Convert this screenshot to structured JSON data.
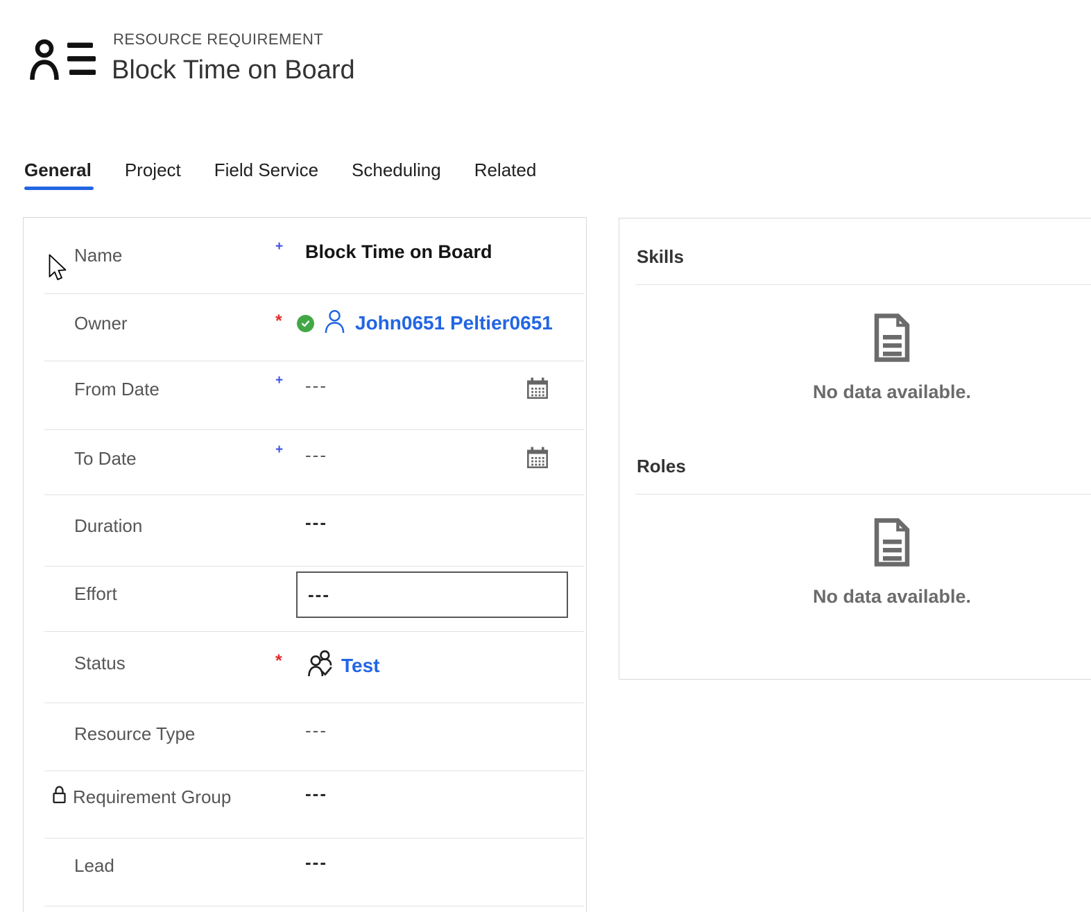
{
  "header": {
    "record_type": "RESOURCE REQUIREMENT",
    "record_title": "Block Time on Board",
    "icon": "resource-requirement-icon"
  },
  "tabs": [
    {
      "label": "General",
      "active": true
    },
    {
      "label": "Project",
      "active": false
    },
    {
      "label": "Field Service",
      "active": false
    },
    {
      "label": "Scheduling",
      "active": false
    },
    {
      "label": "Related",
      "active": false
    }
  ],
  "form": {
    "fields": [
      {
        "label": "Name",
        "marker": "+",
        "type": "text",
        "value": "Block Time on Board"
      },
      {
        "label": "Owner",
        "marker": "*",
        "type": "owner",
        "value": "John0651 Peltier0651",
        "icons": [
          "verified-check-icon",
          "person-icon"
        ]
      },
      {
        "label": "From Date",
        "marker": "+",
        "type": "date",
        "value": "---",
        "icons": [
          "calendar-icon"
        ]
      },
      {
        "label": "To Date",
        "marker": "+",
        "type": "date",
        "value": "---",
        "icons": [
          "calendar-icon"
        ]
      },
      {
        "label": "Duration",
        "marker": "",
        "type": "blank-bold",
        "value": "---"
      },
      {
        "label": "Effort",
        "marker": "",
        "type": "input",
        "value": "---"
      },
      {
        "label": "Status",
        "marker": "*",
        "type": "status",
        "value": "Test",
        "icons": [
          "people-check-icon"
        ]
      },
      {
        "label": "Resource Type",
        "marker": "",
        "type": "blank",
        "value": "---"
      },
      {
        "label": "Requirement Group",
        "marker": "",
        "type": "blank-bold",
        "value": "---",
        "locked": true,
        "icons": [
          "lock-icon"
        ]
      },
      {
        "label": "Lead",
        "marker": "",
        "type": "blank-bold",
        "value": "---"
      }
    ]
  },
  "side_sections": [
    {
      "title": "Skills",
      "empty_message": "No data available.",
      "icon": "document-icon"
    },
    {
      "title": "Roles",
      "empty_message": "No data available.",
      "icon": "document-icon"
    }
  ],
  "colors": {
    "accent": "#2266E3",
    "required": "#e32b2b",
    "recommended": "#3f52e0",
    "success": "#42a846",
    "divider": "#e2e2e2",
    "panel_border": "#d8d8d8",
    "label": "#565656",
    "muted": "#6b6b6b",
    "heading": "#333333"
  }
}
